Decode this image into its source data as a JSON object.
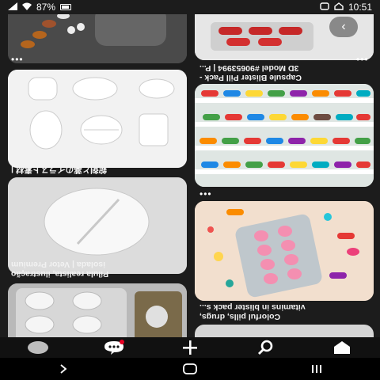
{
  "status_bar": {
    "time": "10:51",
    "battery": "87%"
  },
  "pins": [
    {
      "id": "pin-1",
      "caption": "",
      "has_more": true
    },
    {
      "id": "pin-2",
      "caption": "Capsule Blister Pill Pack -\n3D Model #90653994 | P...",
      "has_more": true,
      "overlay_button": "‹"
    },
    {
      "id": "pin-3",
      "caption": "錠剤と薬のイラスト素材 |\n無料のイラストやかわいいフリー素材",
      "has_more": true
    },
    {
      "id": "pin-4",
      "caption": "",
      "has_more": true
    },
    {
      "id": "pin-5",
      "caption": "Pílula realista, ilustração\nisolada | Vetor Premium",
      "has_more": true
    },
    {
      "id": "pin-6",
      "caption": "Colorful pills, drugs,\nvitamins in blister pack s...",
      "has_more": true
    }
  ],
  "bottom_nav": [
    "home",
    "search",
    "create",
    "messages",
    "profile"
  ],
  "colors": {
    "background": "#1c1c1c",
    "nav": "#111111"
  }
}
